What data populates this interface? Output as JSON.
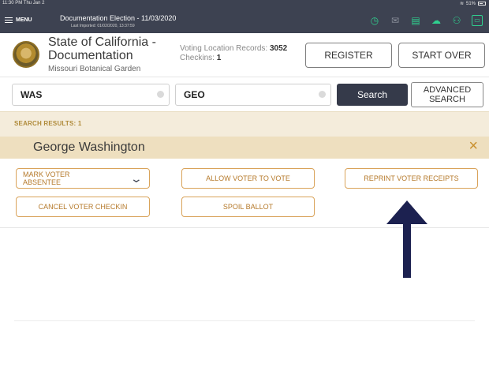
{
  "status_bar": {
    "time": "11:30 PM  Thu Jan 2",
    "battery": "51%"
  },
  "app_bar": {
    "menu_label": "MENU",
    "title": "Documentation Election - 11/03/2020",
    "last_imported": "Last Imported: 01/02/2020, 13:37:59"
  },
  "header": {
    "org_name": "State of California - Documentation",
    "location": "Missouri Botanical Garden",
    "records_label": "Voting Location Records:",
    "records_count": "3052",
    "checkins_label": "Checkins:",
    "checkins_count": "1",
    "register_label": "REGISTER",
    "start_over_label": "START OVER"
  },
  "search": {
    "last_name_value": "WAS",
    "first_name_value": "GEO",
    "search_label": "Search",
    "advanced_label": "ADVANCED SEARCH"
  },
  "results": {
    "label": "SEARCH RESULTS: 1",
    "voter_name": "George  Washington",
    "close_symbol": "×"
  },
  "actions": {
    "mark_absentee": "MARK VOTER ABSENTEE",
    "allow_vote": "ALLOW VOTER TO VOTE",
    "reprint_receipts": "REPRINT VOTER RECEIPTS",
    "cancel_checkin": "CANCEL VOTER CHECKIN",
    "spoil_ballot": "SPOIL BALLOT"
  },
  "icons": [
    "clock-icon",
    "mail-icon",
    "printer-icon",
    "cloud-icon",
    "users-icon",
    "chat-icon"
  ],
  "colors": {
    "app_bar": "#3d4251",
    "accent_green": "#2fd08f",
    "gold": "#b5792a",
    "results_bg": "#f4ecdb",
    "name_bg": "#eedfbf",
    "arrow": "#1c2150"
  }
}
